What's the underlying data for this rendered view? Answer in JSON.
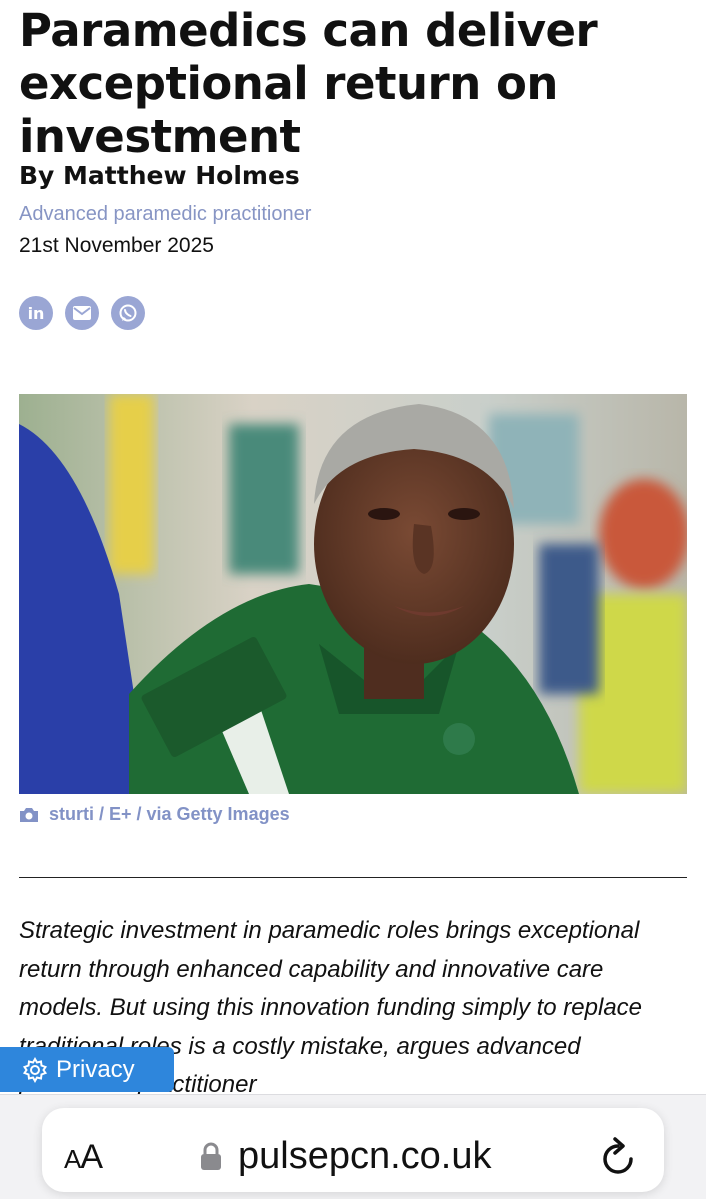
{
  "article": {
    "title": "Paramedics can deliver exceptional return on investment",
    "byline": "By Matthew Holmes",
    "author_role": "Advanced paramedic practitioner",
    "date": "21st November 2025",
    "share": [
      {
        "icon": "linkedin-icon",
        "glyph": "in"
      },
      {
        "icon": "email-icon",
        "glyph": ""
      },
      {
        "icon": "whatsapp-icon",
        "glyph": ""
      }
    ],
    "image_credit": "sturti / E+ / via Getty Images",
    "standfirst": "Strategic investment in paramedic roles brings exceptional return through enhanced capability and innovative care models. But using this innovation funding simply to replace traditional roles is a costly mistake, argues advanced paramedic practitioner"
  },
  "privacy": {
    "label": "Privacy",
    "icon": "gear-icon"
  },
  "browser": {
    "text_size_label_small": "A",
    "text_size_label_large": "A",
    "domain": "pulsepcn.co.uk",
    "lock_icon": "lock-icon",
    "reload_icon": "reload-icon"
  },
  "colors": {
    "accent": "#8795c4",
    "share_circle": "#9aa6d4",
    "privacy_bg": "#2e86dc",
    "uniform_green": "#1f6b34"
  }
}
